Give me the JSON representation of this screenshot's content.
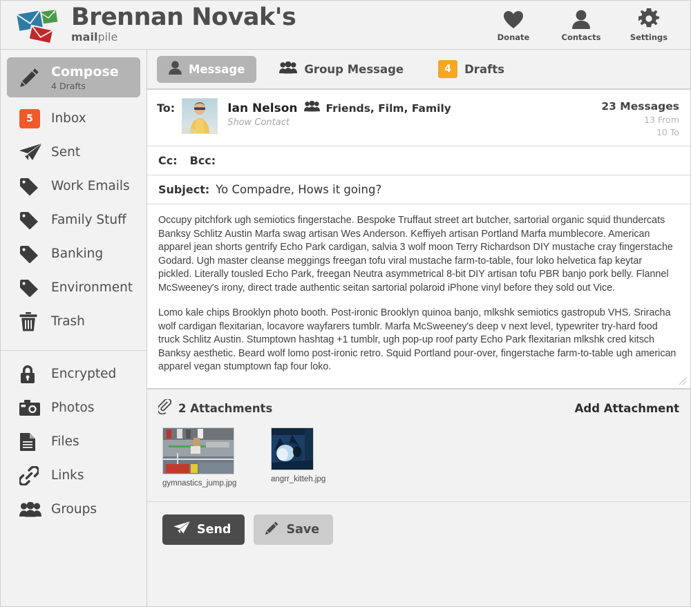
{
  "header": {
    "title": "Brennan Novak's",
    "subtitle_bold": "mail",
    "subtitle_light": "pile",
    "logo_icon": "envelopes-logo-icon",
    "actions": [
      {
        "label": "Donate",
        "icon": "heart-icon"
      },
      {
        "label": "Contacts",
        "icon": "person-icon"
      },
      {
        "label": "Settings",
        "icon": "gear-icon"
      }
    ]
  },
  "sidebar": {
    "groups": [
      {
        "items": [
          {
            "label": "Compose",
            "sub": "4 Drafts",
            "icon": "pencil-icon",
            "active": true
          },
          {
            "label": "Inbox",
            "icon": "badge",
            "badge": "5"
          },
          {
            "label": "Sent",
            "icon": "paper-plane-icon"
          },
          {
            "label": "Work Emails",
            "icon": "tag-icon"
          },
          {
            "label": "Family Stuff",
            "icon": "tag-icon"
          },
          {
            "label": "Banking",
            "icon": "tag-icon"
          },
          {
            "label": "Environment",
            "icon": "tag-icon"
          },
          {
            "label": "Trash",
            "icon": "trash-icon"
          }
        ]
      },
      {
        "items": [
          {
            "label": "Encrypted",
            "icon": "lock-icon"
          },
          {
            "label": "Photos",
            "icon": "camera-icon"
          },
          {
            "label": "Files",
            "icon": "file-icon"
          },
          {
            "label": "Links",
            "icon": "link-icon"
          },
          {
            "label": "Groups",
            "icon": "group-icon"
          }
        ]
      }
    ]
  },
  "tabs": [
    {
      "label": "Message",
      "icon": "person-icon",
      "active": true
    },
    {
      "label": "Group Message",
      "icon": "group-icon",
      "active": false
    },
    {
      "label": "Drafts",
      "icon": "badge",
      "badge": "4",
      "active": false
    }
  ],
  "compose": {
    "to_label": "To:",
    "recipient_name": "Ian Nelson",
    "recipient_groups": "Friends,  Film,  Family",
    "groups_icon": "group-icon",
    "show_contact": "Show Contact",
    "avatar": "contact-avatar",
    "counts": {
      "messages": "23 Messages",
      "from": "13 From",
      "to": "10 To"
    },
    "cc_label": "Cc:",
    "bcc_label": "Bcc:",
    "cc_value": "",
    "bcc_value": "",
    "subject_label": "Subject:",
    "subject_value": "Yo Compadre, Hows it going?",
    "body_paragraphs": [
      "Occupy pitchfork ugh semiotics fingerstache. Bespoke Truffaut street art butcher, sartorial organic squid thundercats Banksy Schlitz Austin Marfa swag artisan Wes Anderson. Keffiyeh artisan Portland Marfa mumblecore. American apparel jean shorts gentrify Echo Park cardigan, salvia 3 wolf moon Terry Richardson DIY mustache cray fingerstache Godard. Ugh master cleanse meggings freegan tofu viral mustache farm-to-table, four loko helvetica fap keytar pickled. Literally tousled Echo Park, freegan Neutra asymmetrical 8-bit DIY artisan tofu PBR banjo pork belly. Flannel McSweeney's irony, direct trade authentic seitan sartorial polaroid iPhone vinyl before they sold out Vice.",
      "Lomo kale chips Brooklyn photo booth. Post-ironic Brooklyn quinoa banjo, mlkshk semiotics gastropub VHS. Sriracha wolf cardigan flexitarian, locavore wayfarers tumblr. Marfa McSweeney's deep v next level, typewriter try-hard food truck Schlitz Austin. Stumptown hashtag +1 tumblr, ugh pop-up roof party Echo Park flexitarian mlkshk cred kitsch Banksy aesthetic. Beard wolf lomo post-ironic retro. Squid Portland pour-over, fingerstache farm-to-table ugh american apparel vegan stumptown fap four loko."
    ],
    "resize_grip": "resize-grip"
  },
  "attachments": {
    "icon": "paperclip-icon",
    "title": "2 Attachments",
    "add_label": "Add Attachment",
    "items": [
      {
        "filename": "gymnastics_jump.jpg",
        "kind": "gymnastics-photo"
      },
      {
        "filename": "angrr_kitteh.jpg",
        "kind": "cat-photo"
      }
    ]
  },
  "buttons": {
    "send": "Send",
    "send_icon": "paper-plane-icon",
    "save": "Save",
    "save_icon": "pencil-icon"
  },
  "colors": {
    "badge_orange": "#ef5a28",
    "badge_amber": "#f5a623",
    "active_gray": "#b4b4b4",
    "send_dark": "#4b4b4b",
    "save_gray": "#cccccc",
    "page_bg": "#f2f2f2"
  }
}
